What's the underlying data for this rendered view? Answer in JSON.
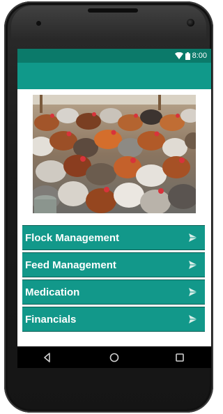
{
  "status": {
    "time": "8:00",
    "wifi_icon": "wifi-icon",
    "battery_icon": "battery-icon"
  },
  "colors": {
    "status_bar": "#0b7a6a",
    "app_bar": "#10998a",
    "menu_bg": "#12988a",
    "menu_border": "#0c5f55",
    "text": "#ffffff"
  },
  "hero": {
    "image_icon": "chickens-photo"
  },
  "menu": {
    "items": [
      {
        "label": "Flock Management",
        "icon": "send-arrow-icon"
      },
      {
        "label": "Feed Management",
        "icon": "send-arrow-icon"
      },
      {
        "label": "Medication",
        "icon": "send-arrow-icon"
      },
      {
        "label": "Financials",
        "icon": "send-arrow-icon"
      }
    ]
  },
  "navbar": {
    "back_icon": "back-icon",
    "home_icon": "home-icon",
    "recents_icon": "recents-icon"
  }
}
